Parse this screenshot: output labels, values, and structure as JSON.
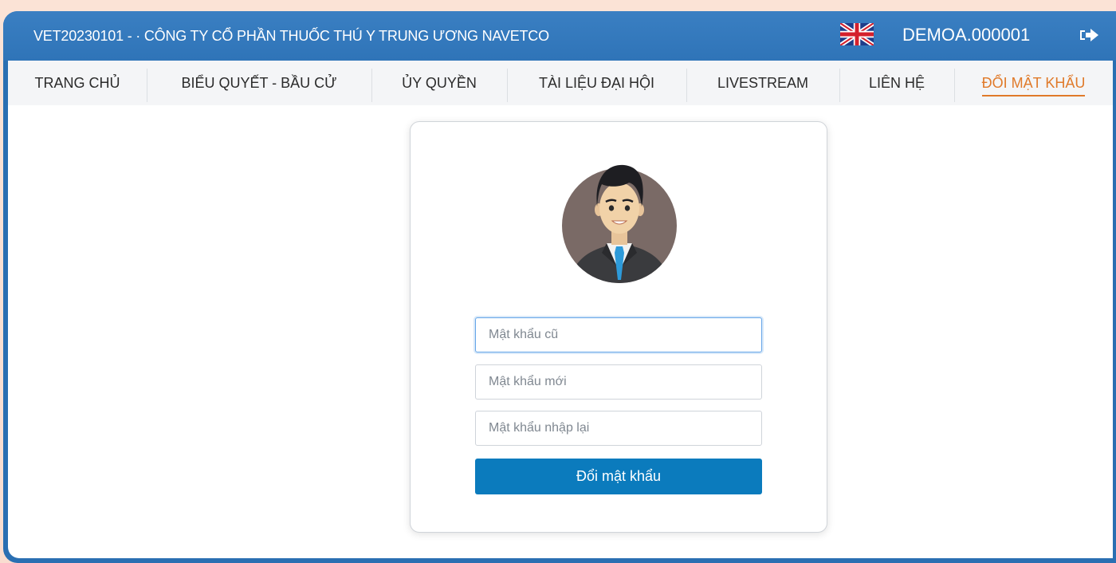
{
  "header": {
    "title": "VET20230101 - · CÔNG TY CỔ PHẦN THUỐC THÚ Y TRUNG ƯƠNG NAVETCO",
    "language_icon": "uk-flag-icon",
    "user_code": "DEMOA.000001",
    "logout_icon": "logout-icon"
  },
  "nav": {
    "items": [
      {
        "label": "TRANG CHỦ",
        "active": false
      },
      {
        "label": "BIỂU QUYẾT - BẦU CỬ",
        "active": false
      },
      {
        "label": "ỦY QUYỀN",
        "active": false
      },
      {
        "label": "TÀI LIỆU ĐẠI HỘI",
        "active": false
      },
      {
        "label": "LIVESTREAM",
        "active": false
      },
      {
        "label": "LIÊN HỆ",
        "active": false
      },
      {
        "label": "ĐỔI MẬT KHẨU",
        "active": true
      }
    ]
  },
  "form": {
    "old_password_placeholder": "Mật khẩu cũ",
    "new_password_placeholder": "Mật khẩu mới",
    "confirm_password_placeholder": "Mật khẩu nhập lại",
    "submit_label": "Đổi mật khẩu"
  },
  "colors": {
    "frame_blue": "#2a6fb2",
    "active_orange": "#e07a2a",
    "button_blue": "#0b7bbd"
  }
}
